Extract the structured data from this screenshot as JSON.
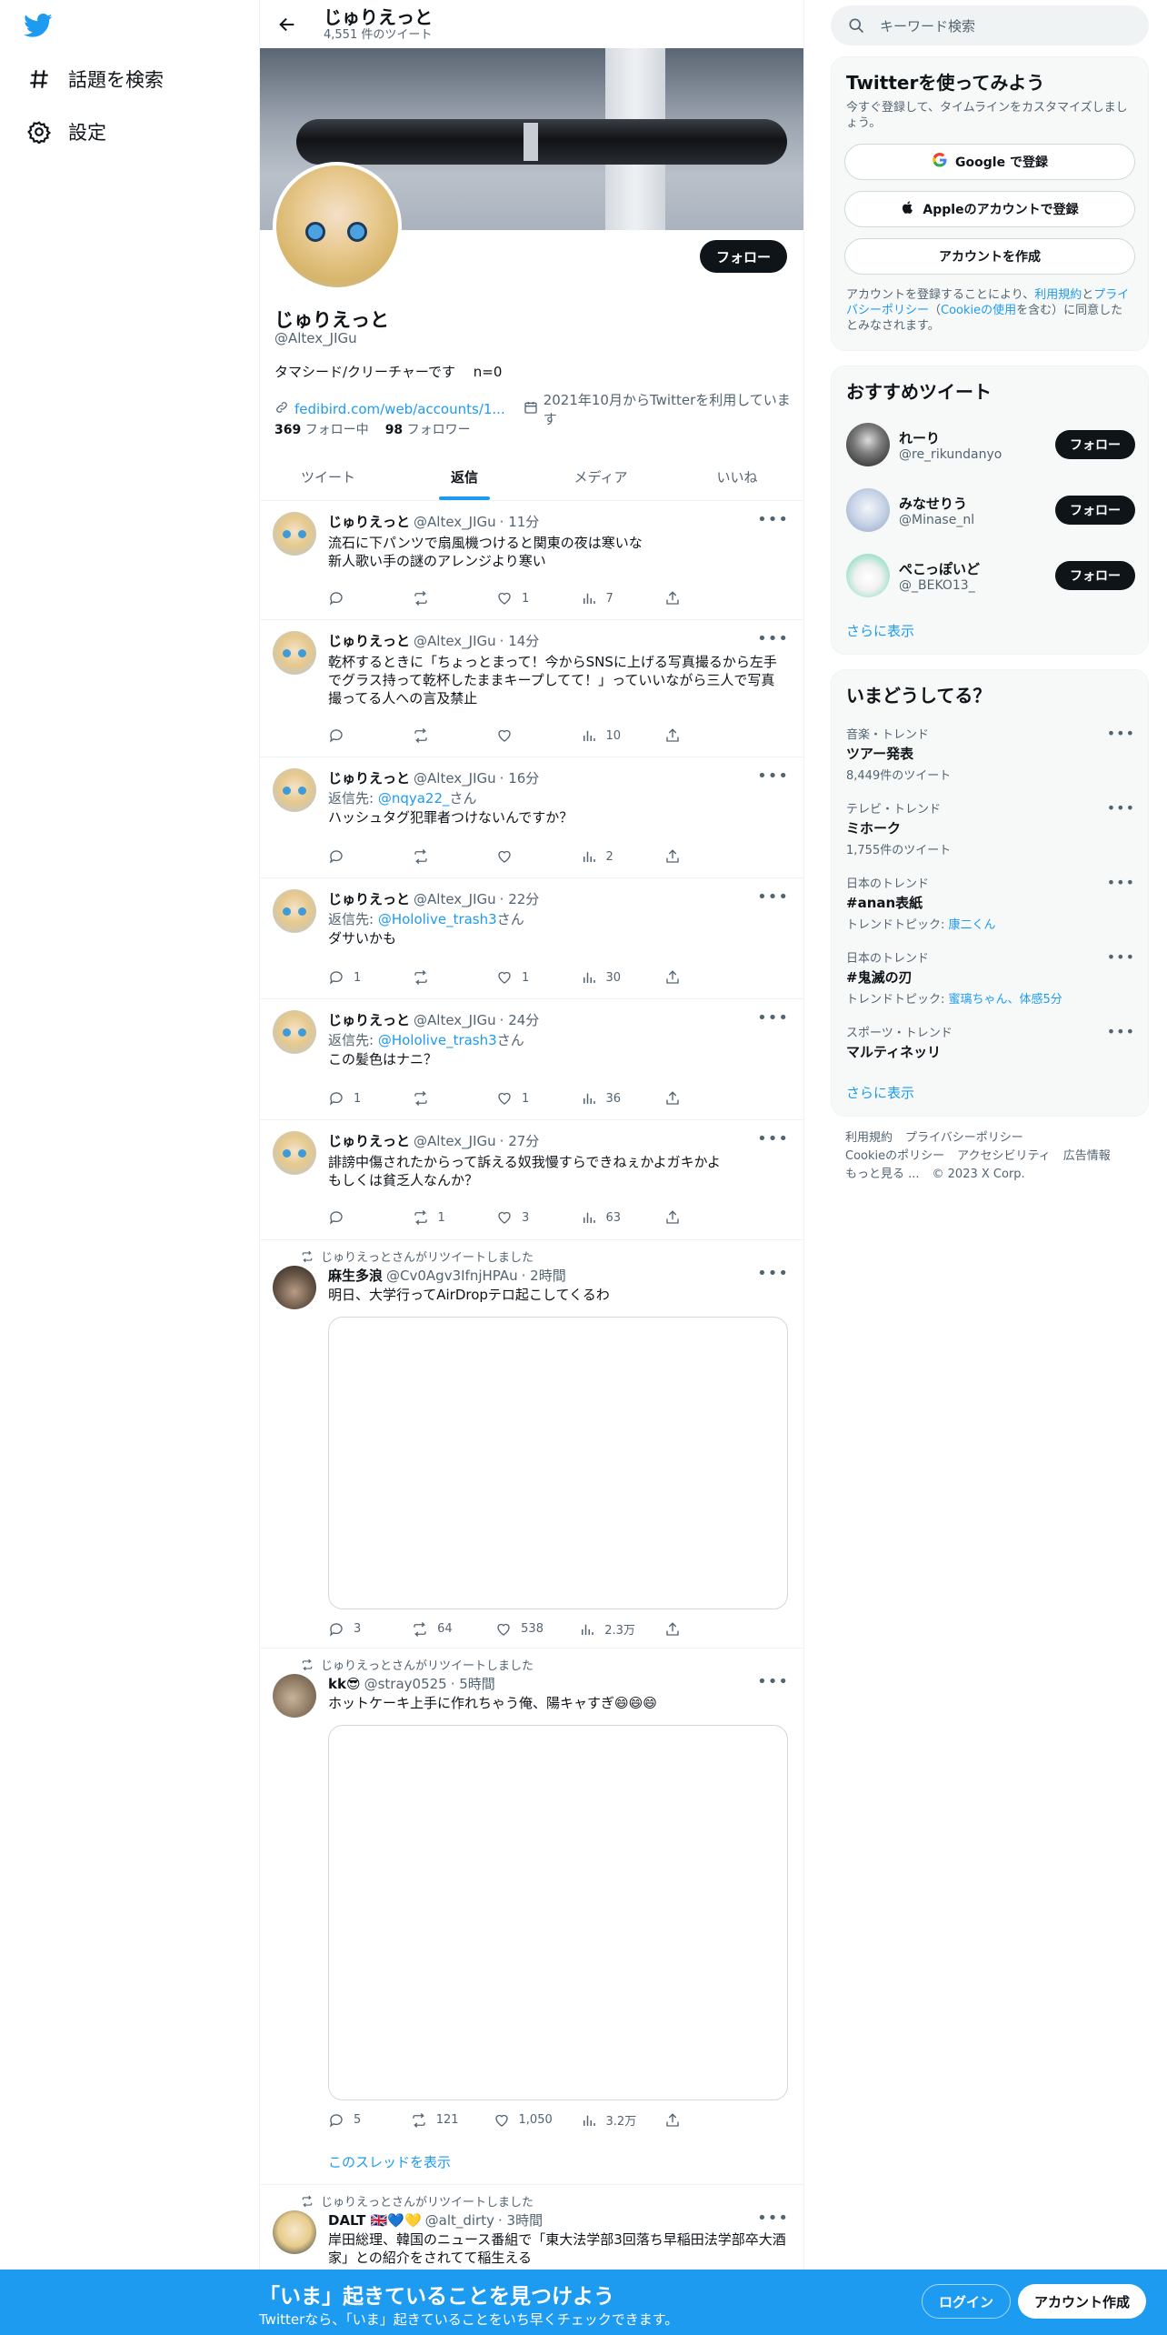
{
  "nav": {
    "items": [
      {
        "label": "話題を検索",
        "icon": "hash-icon"
      },
      {
        "label": "設定",
        "icon": "gear-icon"
      }
    ]
  },
  "profile": {
    "name": "じゅりえっと",
    "tweet_count": "4,551 件のツイート",
    "handle": "@Altex_JIGu",
    "bio": "タマシード/クリーチャーです　 n=0",
    "link": "fedibird.com/web/accounts/1...",
    "joined": "2021年10月からTwitterを利用しています",
    "following_count": "369",
    "following_label": "フォロー中",
    "followers_count": "98",
    "followers_label": "フォロワー",
    "follow_button": "フォロー"
  },
  "tabs": [
    "ツイート",
    "返信",
    "メディア",
    "いいね"
  ],
  "tweets": [
    {
      "name": "じゅりえっと",
      "handle": "@Altex_JIGu",
      "time": "· 11分",
      "text": [
        "流石に下パンツで扇風機つけると関東の夜は寒いな",
        "新人歌い手の謎のアレンジより寒い"
      ],
      "likes": "1",
      "views": "7"
    },
    {
      "name": "じゅりえっと",
      "handle": "@Altex_JIGu",
      "time": "· 14分",
      "text": [
        "乾杯するときに「ちょっとまって！今からSNSに上げる写真撮るから左手",
        "でグラス持って乾杯したままキープしてて！」っていいながら三人で写真",
        "撮ってる人への言及禁止"
      ],
      "views": "10"
    },
    {
      "name": "じゅりえっと",
      "handle": "@Altex_JIGu",
      "time": "· 16分",
      "reply_prefix": "返信先: ",
      "reply_to": "@nqya22_",
      "reply_suffix": "さん",
      "text": [
        "ハッシュタグ犯罪者つけないんですか？"
      ],
      "views": "2"
    },
    {
      "name": "じゅりえっと",
      "handle": "@Altex_JIGu",
      "time": "· 22分",
      "reply_prefix": "返信先: ",
      "reply_to": "@Hololive_trash3",
      "reply_suffix": "さん",
      "text": [
        "ダサいかも"
      ],
      "replies": "1",
      "likes": "1",
      "views": "30"
    },
    {
      "name": "じゅりえっと",
      "handle": "@Altex_JIGu",
      "time": "· 24分",
      "reply_prefix": "返信先: ",
      "reply_to": "@Hololive_trash3",
      "reply_suffix": "さん",
      "text": [
        "この髪色はナニ？"
      ],
      "replies": "1",
      "likes": "1",
      "views": "36"
    },
    {
      "name": "じゅりえっと",
      "handle": "@Altex_JIGu",
      "time": "· 27分",
      "text": [
        "誹謗中傷されたからって訴える奴我慢すらできねぇかよガキかよ",
        "もしくは貧乏人なんか？"
      ],
      "retweets": "1",
      "likes": "3",
      "views": "63"
    },
    {
      "retweeted_by": "じゅりえっとさんがリツイートしました",
      "name": "麻生多浪",
      "handle": "@Cv0Agv3IfnjHPAu",
      "time": "· 2時間",
      "text": [
        "明日、大学行ってAirDropテロ起こしてくるわ"
      ],
      "replies": "3",
      "retweets": "64",
      "likes": "538",
      "views": "2.3万"
    },
    {
      "retweeted_by": "じゅりえっとさんがリツイートしました",
      "name": "kk😎",
      "handle": "@stray0525",
      "time": "· 5時間",
      "text": [
        "ホットケーキ上手に作れちゃう俺、陽キャすぎ😄😄😄"
      ],
      "replies": "5",
      "retweets": "121",
      "likes": "1,050",
      "views": "3.2万",
      "thread_link": "このスレッドを表示"
    },
    {
      "retweeted_by": "じゅりえっとさんがリツイートしました",
      "name": "DALT 🇬🇧💙💛",
      "handle": "@alt_dirty",
      "time": "· 3時間",
      "text": [
        "岸田総理、韓国のニュース番組で「東大法学部3回落ち早稲田法学部卒大酒",
        "家」との紹介をされてて稲生える"
      ]
    }
  ],
  "sidebar": {
    "search_placeholder": "キーワード検索",
    "signup": {
      "title": "Twitterを使ってみよう",
      "desc": "今すぐ登録して、タイムラインをカスタマイズしましょう。",
      "google": "Google で登録",
      "apple": "Appleのアカウントで登録",
      "create": "アカウントを作成",
      "legal_1": "アカウントを登録することにより、",
      "legal_terms": "利用規約",
      "legal_2": "と",
      "legal_privacy": "プライバシーポリシー",
      "legal_3": "（",
      "legal_cookie": "Cookieの使用",
      "legal_4": "を含む）に同意したとみなされます。"
    },
    "recommended": {
      "title": "おすすめツイート",
      "users": [
        {
          "name": "れーり",
          "handle": "@re_rikundanyo"
        },
        {
          "name": "みなせりう",
          "handle": "@Minase_nl"
        },
        {
          "name": "ぺこっぽいど",
          "handle": "@_BEKO13_"
        }
      ],
      "follow": "フォロー",
      "more": "さらに表示"
    },
    "trends": {
      "title": "いまどうしてる？",
      "items": [
        {
          "category": "音楽・トレンド",
          "title": "ツアー発表",
          "sub": "8,449件のツイート"
        },
        {
          "category": "テレビ・トレンド",
          "title": "ミホーク",
          "sub": "1,755件のツイート"
        },
        {
          "category": "日本のトレンド",
          "title": "#anan表紙",
          "sub_prefix": "トレンドトピック: ",
          "sub_link": "康二くん"
        },
        {
          "category": "日本のトレンド",
          "title": "#鬼滅の刃",
          "sub_prefix": "トレンドトピック: ",
          "sub_link": "蜜璃ちゃん、体感5分"
        },
        {
          "category": "スポーツ・トレンド",
          "title": "マルティネッリ"
        }
      ],
      "more": "さらに表示"
    },
    "footer": [
      "利用規約",
      "プライバシーポリシー",
      "Cookieのポリシー",
      "アクセシビリティ",
      "広告情報",
      "もっと見る ...",
      "© 2023 X Corp."
    ]
  },
  "bottom_bar": {
    "title": "「いま」起きていることを見つけよう",
    "subtitle": "Twitterなら、「いま」起きていることをいち早くチェックできます。",
    "login": "ログイン",
    "signup": "アカウント作成"
  },
  "colors": {
    "accent": "#1d9bf0",
    "text": "#0f1419",
    "muted": "#536471",
    "button_dark": "#0f1419"
  }
}
